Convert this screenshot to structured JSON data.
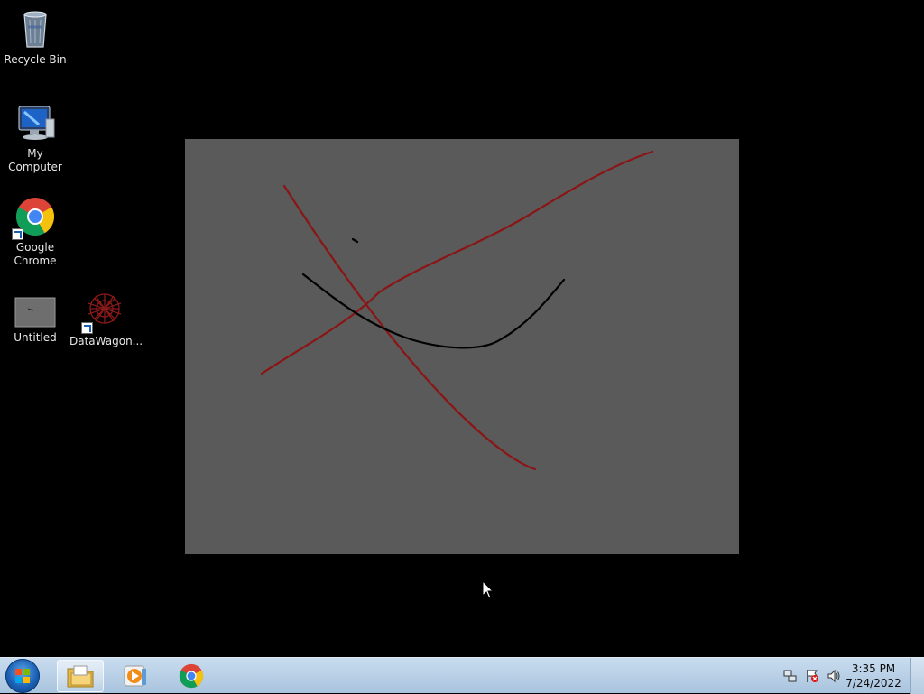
{
  "desktop": {
    "icons": [
      {
        "label": "Recycle Bin",
        "icon": "recycle-bin-icon"
      },
      {
        "label": "My Computer",
        "icon": "computer-icon"
      },
      {
        "label": "Google Chrome",
        "icon": "chrome-icon"
      },
      {
        "label": "Untitled",
        "icon": "image-file-icon"
      },
      {
        "label": "DataWagon...",
        "icon": "datawagon-icon"
      }
    ]
  },
  "canvas": {
    "background": "#5a5a5a",
    "stroke_colors": [
      "#8b1414",
      "#000000"
    ]
  },
  "taskbar": {
    "start_icon": "windows-start-icon",
    "pinned": [
      "file-explorer-icon",
      "media-player-icon",
      "chrome-icon"
    ],
    "tray_icons": [
      "network-icon",
      "action-center-icon",
      "volume-icon"
    ],
    "clock": {
      "time": "3:35 PM",
      "date": "7/24/2022"
    }
  }
}
